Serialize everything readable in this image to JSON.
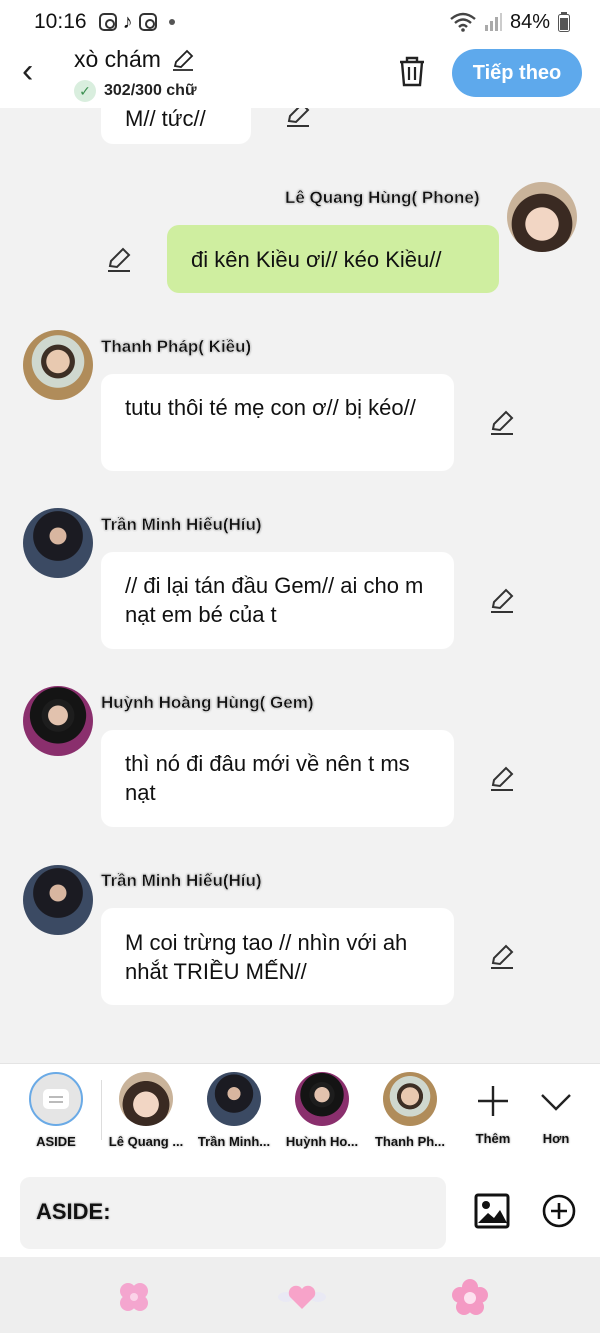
{
  "status": {
    "time": "10:16",
    "battery": "84%"
  },
  "header": {
    "title": "xò chám",
    "count": "302/300 chữ",
    "next_label": "Tiếp theo",
    "back": "‹"
  },
  "messages": [
    {
      "partial_text": "M// tức//"
    },
    {
      "name": "Lê Quang Hùng( Phone)",
      "text": "đi kên Kiều ơi// kéo Kiều//"
    },
    {
      "name": "Thanh Pháp( Kiều)",
      "text": "tutu thôi té mẹ con ơ// bị kéo//"
    },
    {
      "name": "Trần Minh Hiếu(Híu)",
      "text": "// đi lại tán đầu Gem// ai cho m nạt em bé của t"
    },
    {
      "name": "Huỳnh Hoàng Hùng( Gem)",
      "text": "thì nó đi đâu mới về nên t ms nạt"
    },
    {
      "name": "Trần Minh Hiếu(Híu)",
      "text": "M coi trừng tao // nhìn với ah nhắt TRIỀU MẾN//"
    }
  ],
  "cast": [
    {
      "label": "ASIDE"
    },
    {
      "label": "Lê Quang ..."
    },
    {
      "label": "Trần Minh..."
    },
    {
      "label": "Huỳnh Ho..."
    },
    {
      "label": "Thanh Ph..."
    },
    {
      "label": "Thêm"
    },
    {
      "label": "Hơn"
    }
  ],
  "input": {
    "text": "ASIDE:"
  },
  "colors": {
    "accent": "#5ea9ec",
    "green_bubble": "#cfeea0",
    "avatar_purple": "#8a2f6d"
  }
}
